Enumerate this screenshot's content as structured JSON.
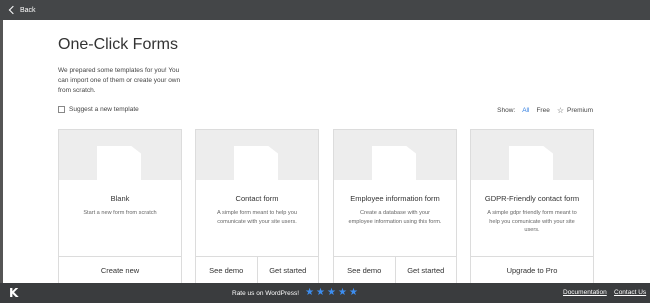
{
  "topbar": {
    "back_label": "Back"
  },
  "page": {
    "title": "One-Click Forms",
    "intro": "We prepared some templates for you! You can import one of them or create your own from scratch."
  },
  "suggest": {
    "label": "Suggest a new template"
  },
  "filter": {
    "show_label": "Show:",
    "all_label": "All",
    "free_label": "Free",
    "premium_label": "Premium"
  },
  "cards": [
    {
      "name": "Blank",
      "desc": "Start a new form from scratch",
      "actions": [
        "Create new"
      ]
    },
    {
      "name": "Contact form",
      "desc": "A simple form meant to help you comunicate with your site users.",
      "actions": [
        "See demo",
        "Get started"
      ]
    },
    {
      "name": "Employee information form",
      "desc": "Create a database with your employee information using this form.",
      "actions": [
        "See demo",
        "Get started"
      ]
    },
    {
      "name": "GDPR-Friendly contact form",
      "desc": "A simple gdpr friendly form meant to help you comunicate with your site users.",
      "actions": [
        "Upgrade to Pro"
      ]
    }
  ],
  "footer": {
    "logo_letter": "K",
    "rate_label": "Rate us on WordPress!",
    "rating": 5,
    "documentation_label": "Documentation",
    "contact_label": "Contact Us"
  },
  "colors": {
    "accent": "#2f7de1",
    "star": "#3d8ef0",
    "topbar": "#444648",
    "footer": "#3a3c3e"
  }
}
